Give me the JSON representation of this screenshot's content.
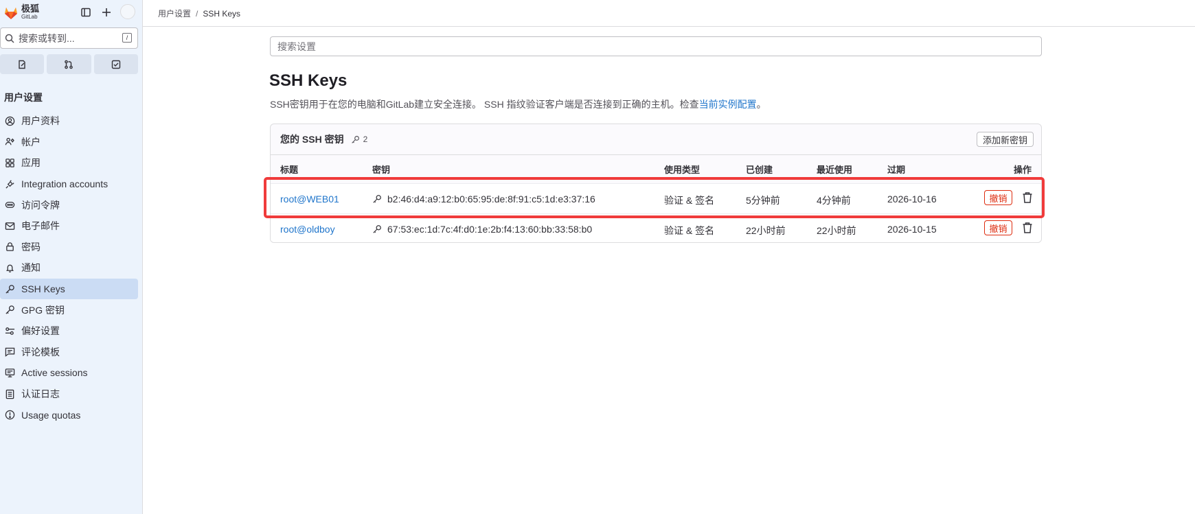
{
  "app": {
    "brand_cn": "极狐",
    "brand_en": "GitLab"
  },
  "sidebar": {
    "search_placeholder": "搜索或转到...",
    "search_shortcut": "/",
    "section_title": "用户设置",
    "items": [
      {
        "label": "用户资料",
        "icon": "user-icon"
      },
      {
        "label": "帐户",
        "icon": "account-icon"
      },
      {
        "label": "应用",
        "icon": "applications-icon"
      },
      {
        "label": "Integration accounts",
        "icon": "plug-icon"
      },
      {
        "label": "访问令牌",
        "icon": "token-icon"
      },
      {
        "label": "电子邮件",
        "icon": "mail-icon"
      },
      {
        "label": "密码",
        "icon": "lock-icon"
      },
      {
        "label": "通知",
        "icon": "bell-icon"
      },
      {
        "label": "SSH Keys",
        "icon": "key-icon",
        "active": true
      },
      {
        "label": "GPG 密钥",
        "icon": "key-icon"
      },
      {
        "label": "偏好设置",
        "icon": "preferences-icon"
      },
      {
        "label": "评论模板",
        "icon": "comment-icon"
      },
      {
        "label": "Active sessions",
        "icon": "monitor-icon"
      },
      {
        "label": "认证日志",
        "icon": "log-icon"
      },
      {
        "label": "Usage quotas",
        "icon": "quota-icon"
      }
    ]
  },
  "breadcrumb": {
    "parent": "用户设置",
    "separator": "/",
    "current": "SSH Keys"
  },
  "main": {
    "search_placeholder": "搜索设置",
    "title": "SSH Keys",
    "description": "SSH密钥用于在您的电脑和GitLab建立安全连接。 SSH 指纹验证客户端是否连接到正确的主机。检查",
    "description_link": "当前实例配置",
    "description_end": "。",
    "card": {
      "title": "您的 SSH 密钥",
      "count": "2",
      "add_button": "添加新密钥",
      "columns": [
        "标题",
        "密钥",
        "使用类型",
        "已创建",
        "最近使用",
        "过期",
        "操作"
      ],
      "rows": [
        {
          "title": "root@WEB01",
          "key": "b2:46:d4:a9:12:b0:65:95:de:8f:91:c5:1d:e3:37:16",
          "usage": "验证 & 签名",
          "created": "5分钟前",
          "last_used": "4分钟前",
          "expires": "2026-10-16",
          "revoke": "撤销"
        },
        {
          "title": "root@oldboy",
          "key": "67:53:ec:1d:7c:4f:d0:1e:2b:f4:13:60:bb:33:58:b0",
          "usage": "验证 & 签名",
          "created": "22小时前",
          "last_used": "22小时前",
          "expires": "2026-10-15",
          "revoke": "撤销"
        }
      ]
    }
  },
  "colors": {
    "highlight": "#f03b3b",
    "link": "#1f75cb",
    "danger": "#dd2b0e",
    "sidebar_bg": "#ecf3fc"
  }
}
